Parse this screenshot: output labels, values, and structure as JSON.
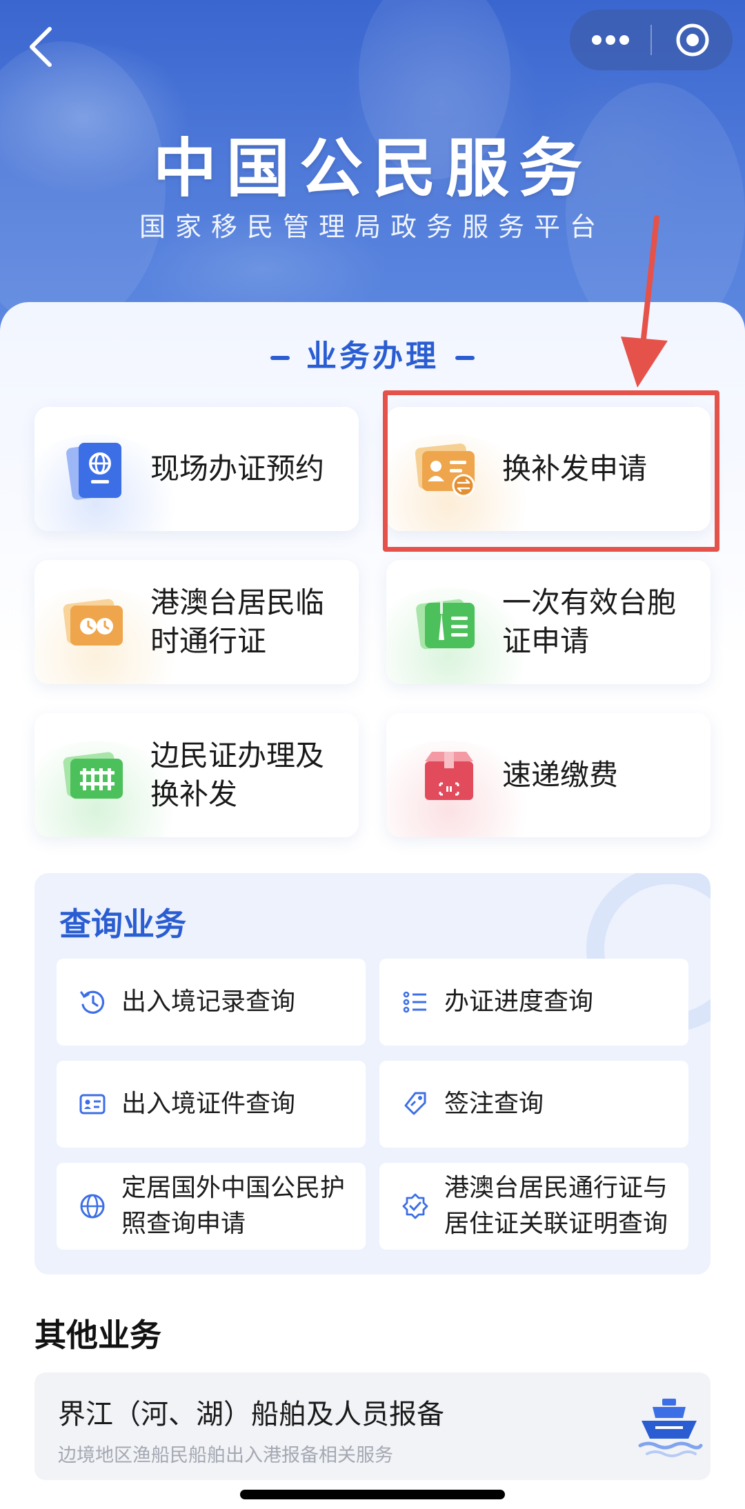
{
  "header": {
    "title": "中国公民服务",
    "subtitle": "国家移民管理局政务服务平台"
  },
  "business": {
    "section_title": "业务办理",
    "items": [
      {
        "label": "现场办证预约",
        "icon": "passport-icon"
      },
      {
        "label": "换补发申请",
        "icon": "id-card-exchange-icon"
      },
      {
        "label": "港澳台居民临时通行证",
        "icon": "permit-clock-icon"
      },
      {
        "label": "一次有效台胞证申请",
        "icon": "taiwan-permit-icon"
      },
      {
        "label": "边民证办理及换补发",
        "icon": "border-card-icon"
      },
      {
        "label": "速递缴费",
        "icon": "express-box-icon"
      }
    ]
  },
  "query": {
    "title": "查询业务",
    "items": [
      {
        "label": "出入境记录查询",
        "icon": "history-icon"
      },
      {
        "label": "办证进度查询",
        "icon": "checklist-icon"
      },
      {
        "label": "出入境证件查询",
        "icon": "id-card-icon"
      },
      {
        "label": "签注查询",
        "icon": "tag-icon"
      },
      {
        "label": "定居国外中国公民护照查询申请",
        "icon": "globe-icon"
      },
      {
        "label": "港澳台居民通行证与居住证关联证明查询",
        "icon": "verified-badge-icon"
      }
    ]
  },
  "other": {
    "title": "其他业务",
    "card_title": "界江（河、湖）船舶及人员报备",
    "card_subtitle": "边境地区渔船民船舶出入港报备相关服务",
    "icon": "ship-icon"
  },
  "colors": {
    "brand_blue": "#2a5dd1",
    "highlight_red": "#e5524a"
  }
}
